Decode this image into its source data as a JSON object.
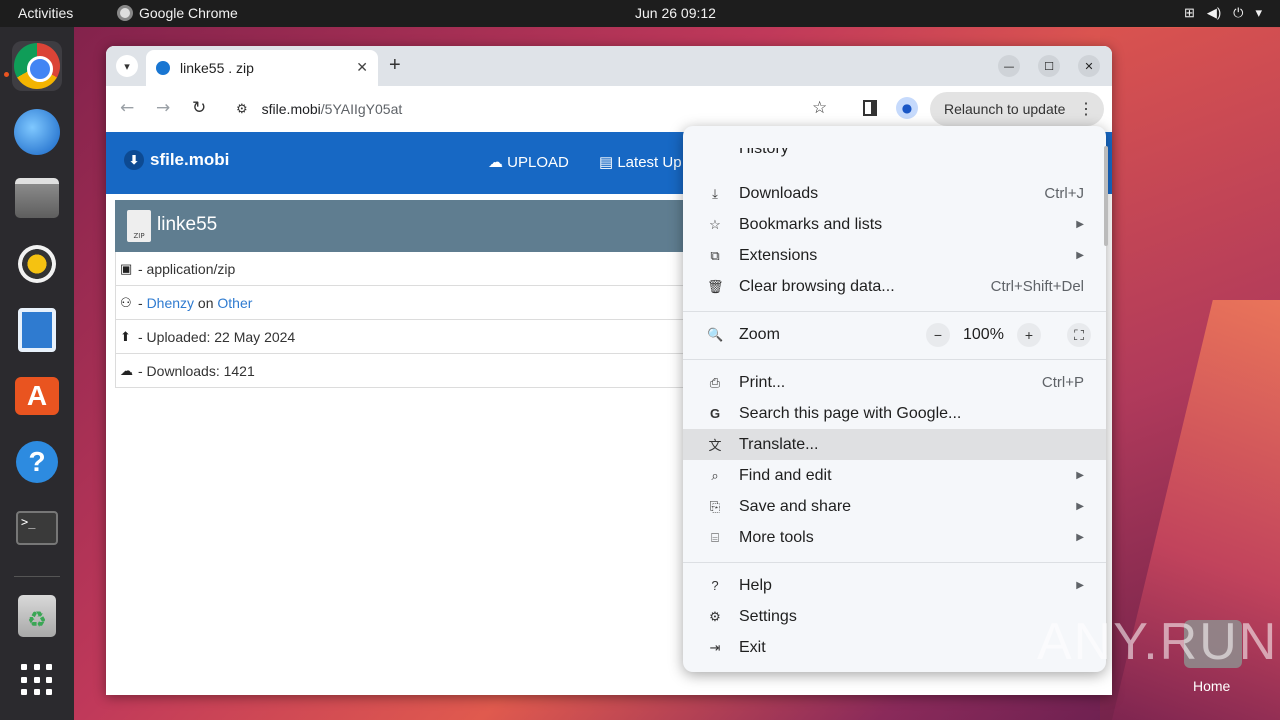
{
  "topbar": {
    "activities": "Activities",
    "app_name": "Google Chrome",
    "clock": "Jun 26  09:12",
    "tray_icons": [
      "network-icon",
      "volume-icon",
      "power-icon",
      "chevron-down-icon"
    ]
  },
  "dock": {
    "items": [
      "chrome",
      "thunderbird",
      "files",
      "rhythmbox",
      "writer",
      "app-center",
      "help",
      "terminal",
      "trash",
      "show-apps"
    ]
  },
  "browser": {
    "tab_title": "linke55 . zip",
    "url_host": "sfile.mobi",
    "url_path": "/5YAIIgY05at",
    "relaunch_label": "Relaunch to update"
  },
  "site": {
    "logo_text": "sfile.mobi",
    "nav_upload": "UPLOAD",
    "nav_latest": "Latest Up",
    "file_name": "linke55",
    "zip_tag": "ZIP",
    "mime": "- application/zip",
    "by_prefix": "- ",
    "uploader": "Dhenzy",
    "on_text": " on ",
    "category": "Other",
    "uploaded": "- Uploaded: 22 May 2024",
    "downloads": "- Downloads: 1421"
  },
  "menu": {
    "history": "History",
    "downloads": "Downloads",
    "downloads_sc": "Ctrl+J",
    "bookmarks": "Bookmarks and lists",
    "extensions": "Extensions",
    "clear": "Clear browsing data...",
    "clear_sc": "Ctrl+Shift+Del",
    "zoom": "Zoom",
    "zoom_value": "100%",
    "print": "Print...",
    "print_sc": "Ctrl+P",
    "search_google": "Search this page with Google...",
    "translate": "Translate...",
    "find_edit": "Find and edit",
    "save_share": "Save and share",
    "more_tools": "More tools",
    "help": "Help",
    "settings": "Settings",
    "exit": "Exit"
  },
  "desktop": {
    "watermark": "ANY.RUN",
    "home_label": "Home"
  },
  "colors": {
    "site_nav": "#1768c4",
    "file_header": "#5f7d90",
    "link": "#2f7bd0",
    "ubuntu_accent": "#e95420"
  }
}
